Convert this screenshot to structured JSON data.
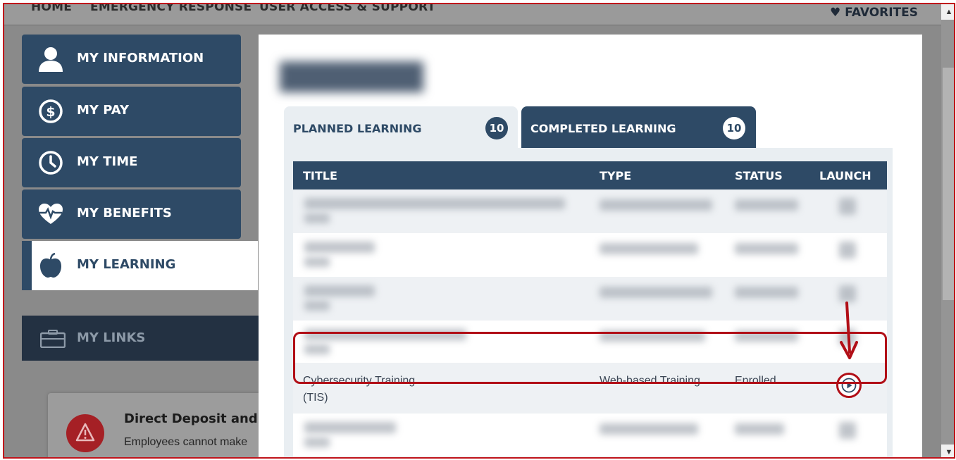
{
  "topnav": {
    "links": [
      "HOME",
      "EMERGENCY RESPONSE",
      "USER ACCESS & SUPPORT"
    ],
    "favorites_label": "FAVORITES"
  },
  "sidebar": {
    "items": [
      {
        "label": "MY INFORMATION",
        "icon": "user-icon"
      },
      {
        "label": "MY PAY",
        "icon": "dollar-icon"
      },
      {
        "label": "MY TIME",
        "icon": "clock-icon"
      },
      {
        "label": "MY BENEFITS",
        "icon": "heartbeat-icon"
      },
      {
        "label": "MY LEARNING",
        "icon": "apple-icon",
        "active": true
      }
    ]
  },
  "links": {
    "header": "MY LINKS",
    "card_title": "Direct Deposit and W",
    "card_text": "Employees cannot make"
  },
  "modal": {
    "tabs": [
      {
        "label": "PLANNED LEARNING",
        "count": "10"
      },
      {
        "label": "COMPLETED LEARNING",
        "count": "10"
      }
    ],
    "columns": {
      "title": "TITLE",
      "type": "TYPE",
      "status": "STATUS",
      "launch": "LAUNCH"
    },
    "highlighted_row": {
      "title_line1": "Cybersecurity Training",
      "title_line2": "(TIS)",
      "type": "Web-based Training",
      "status": "Enrolled"
    }
  },
  "colors": {
    "navy": "#2e4a66",
    "highlight": "#b10f17",
    "alert": "#a52025"
  }
}
